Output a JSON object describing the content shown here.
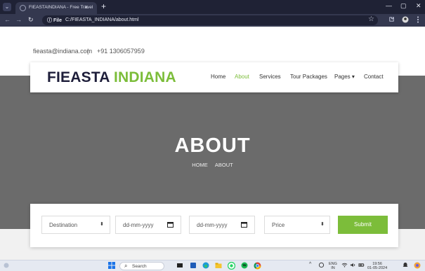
{
  "browser": {
    "tab_title": "FIEASTAINDIANA - Free Travel",
    "tab_close": "×",
    "new_tab": "+",
    "menu": "⌄",
    "minimize": "—",
    "maximize": "▢",
    "close": "✕",
    "back": "←",
    "forward": "→",
    "reload": "↻",
    "file_chip": "ⓘ File",
    "url": "C:/FIEASTA_INDIANA/about.html",
    "star": "☆"
  },
  "topbar": {
    "email": "fieasta@indiana.com",
    "separator": "|",
    "phone": "+91 1306057959"
  },
  "brand": {
    "part1": "FIEASTA",
    "part2": "INDIANA"
  },
  "nav": {
    "items": [
      {
        "label": "Home"
      },
      {
        "label": "About"
      },
      {
        "label": "Services"
      },
      {
        "label": "Tour Packages"
      },
      {
        "label": "Pages ▾"
      },
      {
        "label": "Contact"
      }
    ]
  },
  "hero": {
    "title": "ABOUT",
    "breadcrumb_home": "HOME",
    "breadcrumb_current": "ABOUT"
  },
  "booking": {
    "destination": "Destination",
    "date1": "dd-mm-yyyy",
    "date2": "dd-mm-yyyy",
    "price": "Price",
    "submit": "Submit",
    "select_arrow": "⬍",
    "calendar_icon": "▆"
  },
  "taskbar": {
    "search": "Search",
    "lang_line1": "ENG",
    "lang_line2": "IN",
    "time": "19:56",
    "date": "01-05-2024"
  },
  "colors": {
    "accent": "#7cbd3a",
    "brand_dark": "#1e1e3a",
    "hero_bg": "#6b6b6b"
  }
}
